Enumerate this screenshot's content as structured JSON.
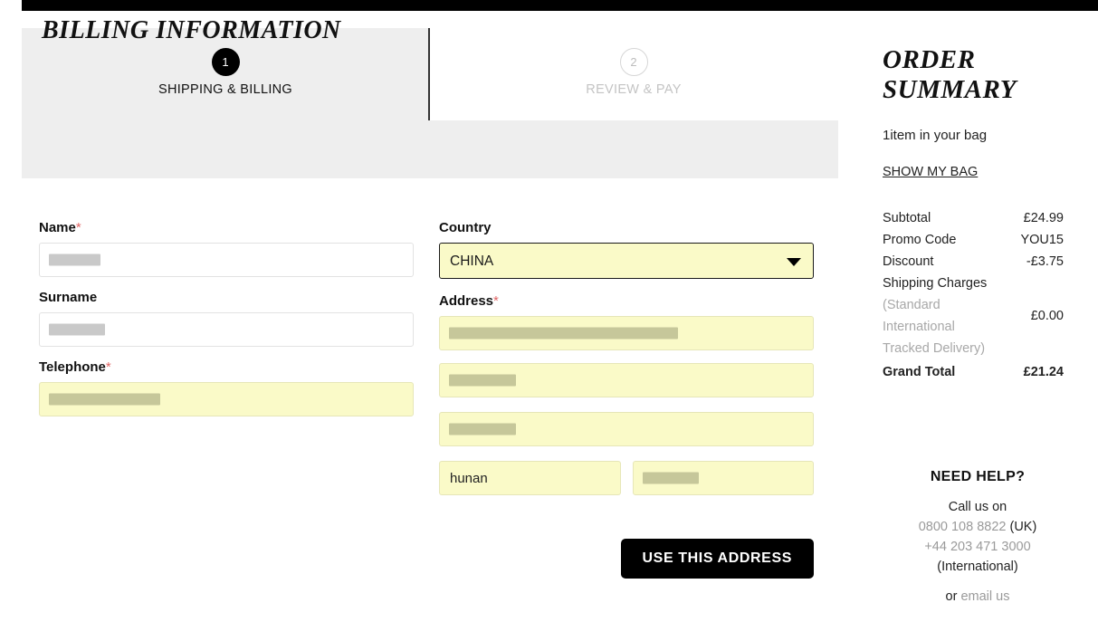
{
  "checkout": {
    "steps": [
      {
        "number": "1",
        "label": "SHIPPING & BILLING",
        "state": "active"
      },
      {
        "number": "2",
        "label": "REVIEW & PAY",
        "state": "inactive"
      }
    ],
    "section_title": "BILLING INFORMATION"
  },
  "form": {
    "name": {
      "label": "Name",
      "required_mark": "*",
      "value": "",
      "placeholder": ""
    },
    "surname": {
      "label": "Surname",
      "required_mark": "",
      "value": "",
      "placeholder": ""
    },
    "telephone": {
      "label": "Telephone",
      "required_mark": "*",
      "value": "",
      "placeholder": ""
    },
    "country": {
      "label": "Country",
      "selected": "CHINA",
      "options": [
        "CHINA"
      ],
      "arrow_icon": "chevron-down-icon"
    },
    "address": {
      "label": "Address",
      "required_mark": "*",
      "line1": "",
      "line2": "",
      "line3": "",
      "city": "hunan",
      "postcode": ""
    },
    "submit_label": "USE THIS ADDRESS"
  },
  "order_summary": {
    "title": "ORDER SUMMARY",
    "bag_count_text": "1item in your bag",
    "show_bag_label": "SHOW MY BAG",
    "lines": [
      {
        "label": "Subtotal",
        "value": "£24.99"
      },
      {
        "label": "Promo Code",
        "value": "YOU15"
      },
      {
        "label": "Discount",
        "value": "-£3.75"
      }
    ],
    "shipping": {
      "label": "Shipping Charges",
      "detail": "(Standard International Tracked Delivery)",
      "value": "£0.00"
    },
    "grand_total": {
      "label": "Grand Total",
      "value": "£21.24"
    }
  },
  "need_help": {
    "title": "NEED HELP?",
    "call_us_on": "Call us on",
    "phone_uk": "0800 108 8822",
    "phone_uk_suffix": "(UK)",
    "phone_intl": "+44 203 471 3000",
    "phone_intl_suffix": "(International)",
    "or_text": "or ",
    "email_label": "email us"
  },
  "colors": {
    "panel_grey": "#eeeeee",
    "autofill_yellow": "#fafac8",
    "accent_black": "#000000",
    "required_red": "#e06666",
    "muted_grey": "#a8a8a8"
  }
}
